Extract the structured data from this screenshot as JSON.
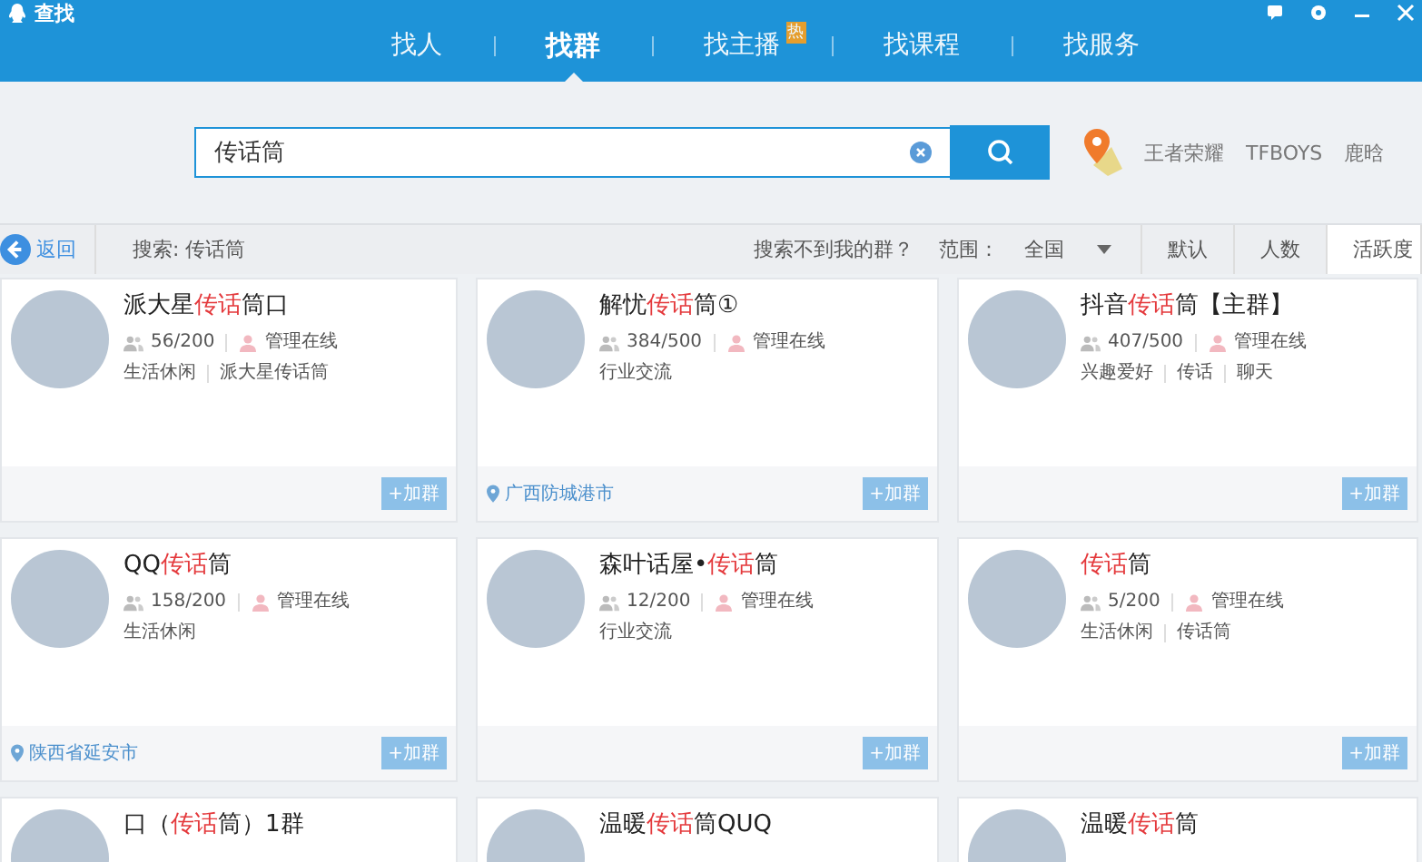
{
  "window": {
    "title": "查找"
  },
  "tabs": [
    {
      "label": "找人",
      "selected": false
    },
    {
      "label": "找群",
      "selected": true
    },
    {
      "label": "找主播",
      "selected": false,
      "badge": "热"
    },
    {
      "label": "找课程",
      "selected": false
    },
    {
      "label": "找服务",
      "selected": false
    }
  ],
  "search": {
    "value": "传话筒"
  },
  "hot_searches": [
    "王者荣耀",
    "TFBOYS",
    "鹿晗"
  ],
  "toolbar": {
    "back": "返回",
    "query": "搜索: 传话筒",
    "help_link": "搜索不到我的群？",
    "range_label": "范围：",
    "range_value": "全国",
    "sort_options": [
      {
        "label": "默认",
        "selected": false
      },
      {
        "label": "人数",
        "selected": false
      },
      {
        "label": "活跃度",
        "selected": true
      }
    ]
  },
  "groups": [
    {
      "title": [
        {
          "text": "派大星",
          "highlight": false
        },
        {
          "text": "传话",
          "highlight": true
        },
        {
          "text": "筒口",
          "highlight": false
        }
      ],
      "members": "56/200",
      "admin": "管理在线",
      "tags": [
        "生活休闲",
        "派大星传话筒"
      ],
      "join": "+加群"
    },
    {
      "title": [
        {
          "text": "解忧",
          "highlight": false
        },
        {
          "text": "传话",
          "highlight": true
        },
        {
          "text": "筒①",
          "highlight": false
        }
      ],
      "members": "384/500",
      "admin": "管理在线",
      "tags": [
        "行业交流"
      ],
      "location": "广西防城港市",
      "join": "+加群"
    },
    {
      "title": [
        {
          "text": "抖音",
          "highlight": false
        },
        {
          "text": "传话",
          "highlight": true
        },
        {
          "text": "筒【主群】",
          "highlight": false
        }
      ],
      "members": "407/500",
      "admin": "管理在线",
      "tags": [
        "兴趣爱好",
        "传话",
        "聊天"
      ],
      "join": "+加群"
    },
    {
      "title": [
        {
          "text": "QQ",
          "highlight": false
        },
        {
          "text": "传话",
          "highlight": true
        },
        {
          "text": "筒",
          "highlight": false
        }
      ],
      "members": "158/200",
      "admin": "管理在线",
      "tags": [
        "生活休闲"
      ],
      "location": "陕西省延安市",
      "join": "+加群"
    },
    {
      "title": [
        {
          "text": "森叶话屋•",
          "highlight": false
        },
        {
          "text": "传话",
          "highlight": true
        },
        {
          "text": "筒",
          "highlight": false
        }
      ],
      "members": "12/200",
      "admin": "管理在线",
      "tags": [
        "行业交流"
      ],
      "join": "+加群"
    },
    {
      "title": [
        {
          "text": "传话",
          "highlight": true
        },
        {
          "text": "筒",
          "highlight": false
        }
      ],
      "members": "5/200",
      "admin": "管理在线",
      "tags": [
        "生活休闲",
        "传话筒"
      ],
      "join": "+加群"
    },
    {
      "title": [
        {
          "text": "口（",
          "highlight": false
        },
        {
          "text": "传话",
          "highlight": true
        },
        {
          "text": "筒）1群",
          "highlight": false
        }
      ]
    },
    {
      "title": [
        {
          "text": "温暖",
          "highlight": false
        },
        {
          "text": "传话",
          "highlight": true
        },
        {
          "text": "筒QUQ",
          "highlight": false
        }
      ]
    },
    {
      "title": [
        {
          "text": "温暖",
          "highlight": false
        },
        {
          "text": "传话",
          "highlight": true
        },
        {
          "text": "筒",
          "highlight": false
        }
      ]
    }
  ]
}
